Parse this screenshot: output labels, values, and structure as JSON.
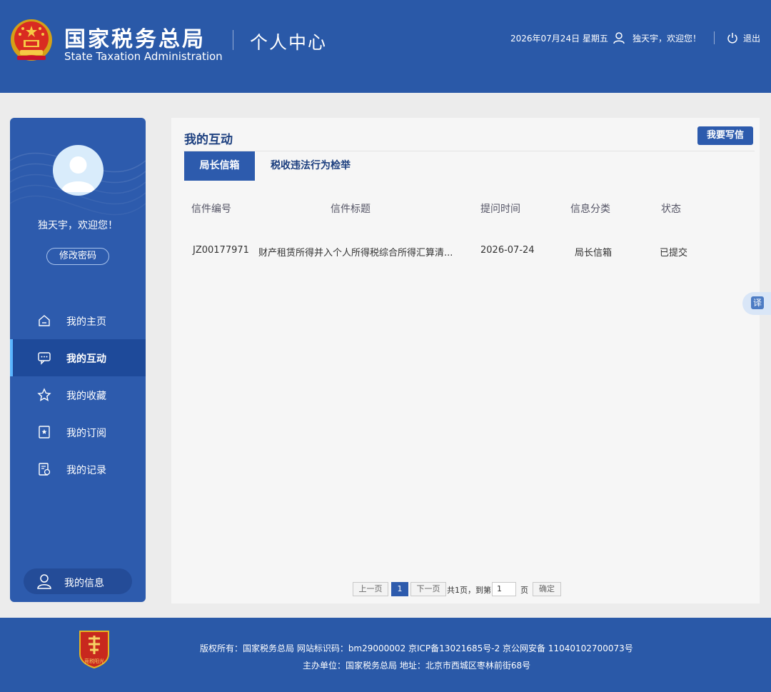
{
  "header": {
    "brand_cn": "国家税务总局",
    "brand_en": "State Taxation Administration",
    "portal_title": "个人中心",
    "date": "2026年07月24日 星期五",
    "user_greeting": "独天宇，欢迎您！",
    "logout_label": "退出"
  },
  "sidebar": {
    "welcome": "独天宇，欢迎您！",
    "change_password": "修改密码",
    "items": [
      {
        "label": "我的主页",
        "icon": "home-icon"
      },
      {
        "label": "我的互动",
        "icon": "chat-icon",
        "active": true
      },
      {
        "label": "我的收藏",
        "icon": "star-icon"
      },
      {
        "label": "我的订阅",
        "icon": "bookmark-icon"
      },
      {
        "label": "我的记录",
        "icon": "record-icon"
      }
    ],
    "my_info": "我的信息"
  },
  "main": {
    "title": "我的互动",
    "write_button": "我要写信",
    "tabs": [
      {
        "label": "局长信箱",
        "active": true
      },
      {
        "label": "税收违法行为检举"
      }
    ],
    "table": {
      "headers": [
        "信件编号",
        "信件标题",
        "提问时间",
        "信息分类",
        "状态"
      ],
      "rows": [
        [
          "JZ00177971",
          "财产租赁所得并入个人所得税综合所得汇算清...",
          "2026-07-24",
          "局长信箱",
          "已提交"
        ]
      ]
    },
    "pagination": {
      "prev": "上一页",
      "current": "1",
      "next": "下一页",
      "total_text": "共1页，到第",
      "page_input": "1",
      "page_unit": "页",
      "confirm": "确定"
    }
  },
  "float": {
    "translate": "译"
  },
  "footer": {
    "line1": "版权所有：国家税务总局   网站标识码：bm29000002      京ICP备13021685号-2   京公网安备 11040102700073号",
    "line2": "主办单位：国家税务总局      地址：北京市西城区枣林前街68号",
    "logo_text": "竞税阳光"
  },
  "colors": {
    "header_blue": "#2a59a8",
    "sidebar_blue": "#2d5bad",
    "active_blue": "#1e4a9a",
    "accent": "#59b4ff"
  }
}
